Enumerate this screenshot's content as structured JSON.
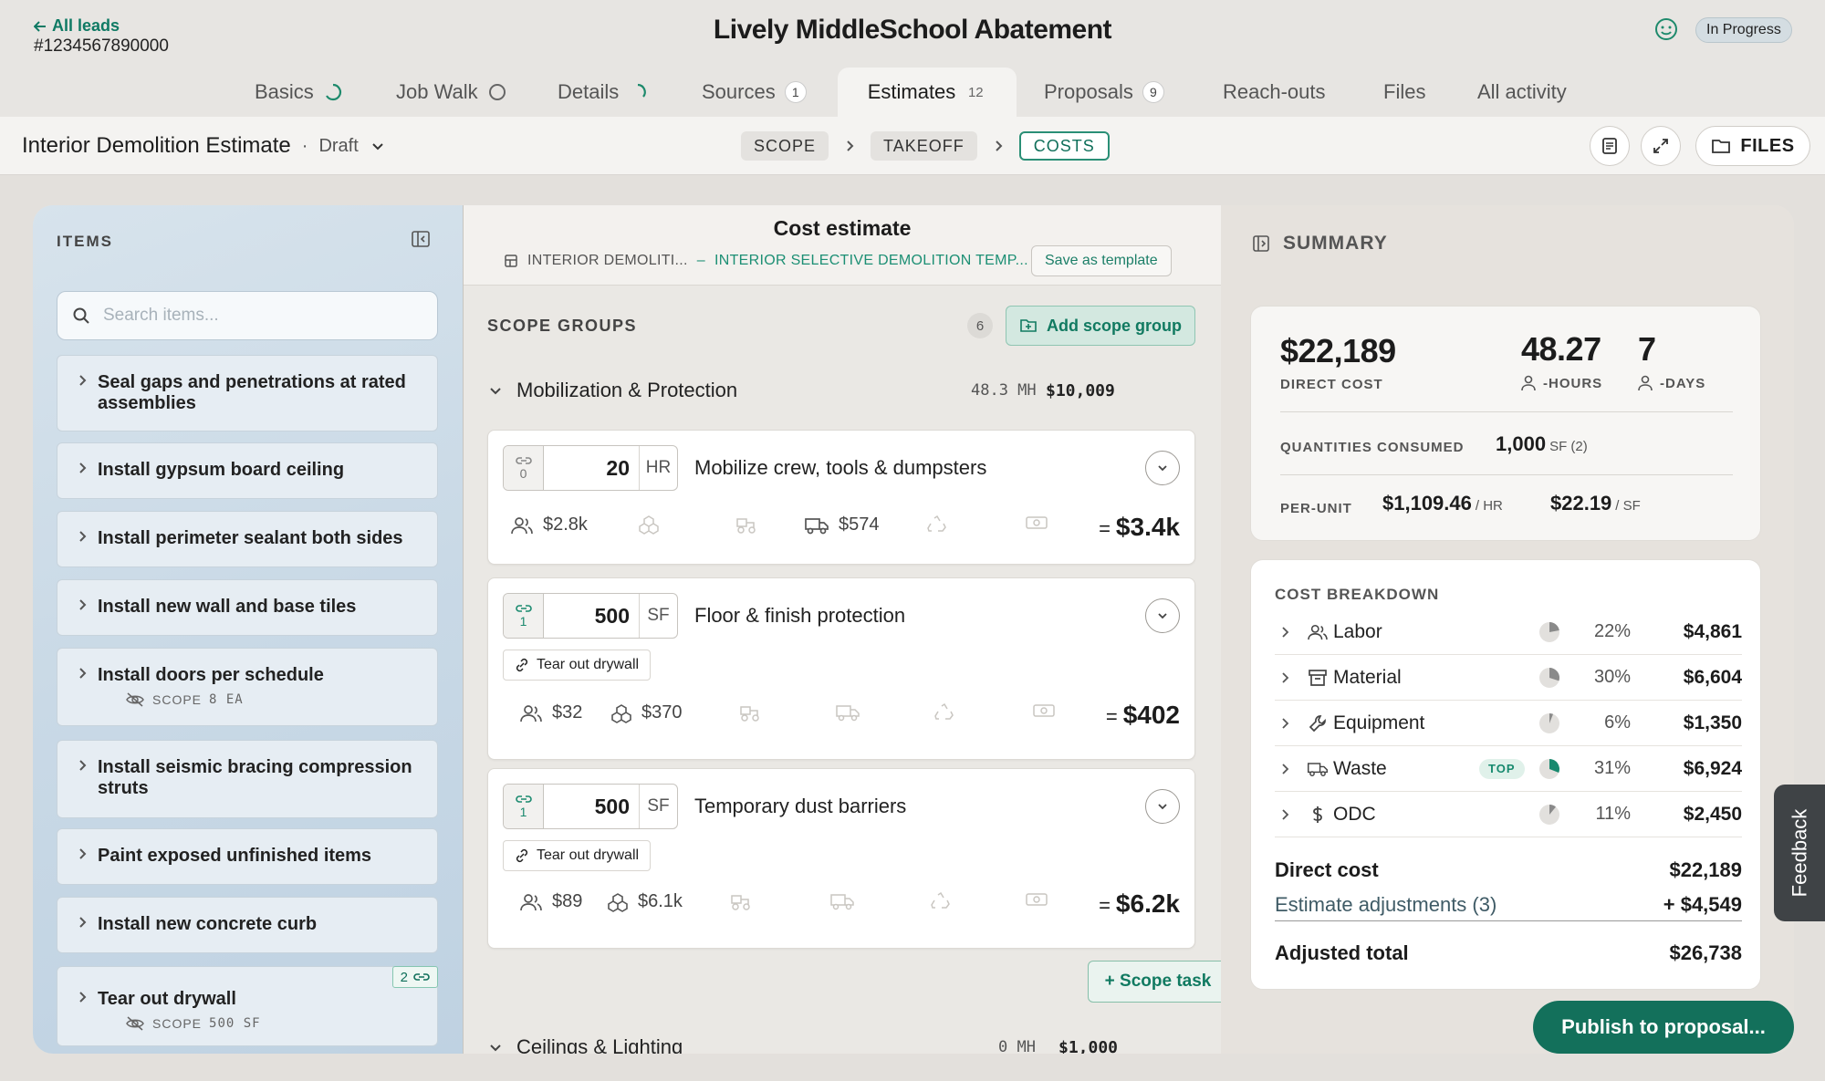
{
  "header": {
    "back_label": "All leads",
    "lead_id": "#1234567890000",
    "title": "Lively MiddleSchool Abatement",
    "status": "In Progress"
  },
  "tabs": [
    {
      "label": "Basics",
      "indicator": "progress-spinner-icon"
    },
    {
      "label": "Job Walk",
      "indicator": "empty-circle-icon"
    },
    {
      "label": "Details",
      "indicator": "progress-spinner-icon"
    },
    {
      "label": "Sources",
      "badge": "1"
    },
    {
      "label": "Estimates",
      "badge": "12",
      "active": true
    },
    {
      "label": "Proposals",
      "badge": "9"
    },
    {
      "label": "Reach-outs"
    },
    {
      "label": "Files"
    },
    {
      "label": "All activity"
    }
  ],
  "subbar": {
    "estimate_name": "Interior Demolition Estimate",
    "estimate_status": "Draft",
    "steps": [
      "SCOPE",
      "TAKEOFF",
      "COSTS"
    ],
    "current_step": "COSTS",
    "files_label": "FILES"
  },
  "items_panel": {
    "heading": "ITEMS",
    "search_placeholder": "Search items...",
    "items": [
      {
        "name": "Seal gaps and penetrations at rated assemblies"
      },
      {
        "name": "Install gypsum board ceiling"
      },
      {
        "name": "Install perimeter sealant both sides"
      },
      {
        "name": "Install new wall and base tiles"
      },
      {
        "name": "Install doors per schedule",
        "scope_label": "SCOPE",
        "scope_value": "8 EA"
      },
      {
        "name": "Install seismic bracing compression struts"
      },
      {
        "name": "Paint exposed unfinished items"
      },
      {
        "name": "Install new concrete curb"
      },
      {
        "name": "Tear out drywall",
        "scope_label": "SCOPE",
        "scope_value": "500 SF",
        "link_count": "2"
      }
    ]
  },
  "cost_estimate": {
    "title": "Cost estimate",
    "path_item": "INTERIOR DEMOLITI...",
    "path_separator": "–",
    "path_template": "INTERIOR SELECTIVE DEMOLITION TEMP...",
    "save_template_label": "Save as template",
    "scope_groups_heading": "SCOPE GROUPS",
    "scope_group_count": "6",
    "add_scope_group_label": "Add scope group",
    "groups": [
      {
        "name": "Mobilization & Protection",
        "mh": "48.3 MH",
        "value": "$10,009"
      },
      {
        "name": "Ceilings & Lighting",
        "mh": "0 MH",
        "value": "$1,000"
      }
    ],
    "tasks": [
      {
        "link_count": "0",
        "quantity": "20",
        "unit": "HR",
        "name": "Mobilize crew, tools & dumpsters",
        "tag": "",
        "labor": "$2.8k",
        "material": "",
        "equipment": "",
        "waste": "$574",
        "recycle": "",
        "odc": "",
        "total_eq": "=",
        "total": "$3.4k"
      },
      {
        "link_count": "1",
        "quantity": "500",
        "unit": "SF",
        "name": "Floor & finish protection",
        "tag": "Tear out drywall",
        "labor": "$32",
        "material": "$370",
        "equipment": "",
        "waste": "",
        "recycle": "",
        "odc": "",
        "total_eq": "=",
        "total": "$402"
      },
      {
        "link_count": "1",
        "quantity": "500",
        "unit": "SF",
        "name": "Temporary dust barriers",
        "tag": "Tear out drywall",
        "labor": "$89",
        "material": "$6.1k",
        "equipment": "",
        "waste": "",
        "recycle": "",
        "odc": "",
        "total_eq": "=",
        "total": "$6.2k"
      }
    ],
    "scope_task_label": "+ Scope task"
  },
  "summary": {
    "heading": "SUMMARY",
    "direct_cost": "$22,189",
    "direct_cost_label": "DIRECT COST",
    "hours": "48.27",
    "hours_label": "-HOURS",
    "days": "7",
    "days_label": "-DAYS",
    "quantities_label": "QUANTITIES CONSUMED",
    "quantities_value": "1,000",
    "quantities_unit": "SF (2)",
    "per_unit_label": "PER-UNIT",
    "per_hr_value": "$1,109.46",
    "per_hr_unit": "/ HR",
    "per_sf_value": "$22.19",
    "per_sf_unit": "/ SF"
  },
  "cost_breakdown": {
    "heading": "COST BREAKDOWN",
    "rows": [
      {
        "name": "Labor",
        "icon": "people-icon",
        "percent": "22%",
        "fraction": 0.22,
        "amount": "$4,861",
        "top": ""
      },
      {
        "name": "Material",
        "icon": "archive-box-icon",
        "percent": "30%",
        "fraction": 0.3,
        "amount": "$6,604",
        "top": ""
      },
      {
        "name": "Equipment",
        "icon": "wrench-icon",
        "percent": "6%",
        "fraction": 0.06,
        "amount": "$1,350",
        "top": ""
      },
      {
        "name": "Waste",
        "icon": "truck-icon",
        "percent": "31%",
        "fraction": 0.31,
        "amount": "$6,924",
        "top": "TOP"
      },
      {
        "name": "ODC",
        "icon": "dollar-icon",
        "percent": "11%",
        "fraction": 0.11,
        "amount": "$2,450",
        "top": ""
      }
    ],
    "direct_cost_label": "Direct cost",
    "direct_cost_value": "$22,189",
    "adjustments_label": "Estimate adjustments (3)",
    "adjustments_value": "+ $4,549",
    "adjusted_total_label": "Adjusted total",
    "adjusted_total_value": "$26,738"
  },
  "actions": {
    "publish_label": "Publish to proposal...",
    "feedback_label": "Feedback"
  },
  "colors": {
    "accent": "#13705b",
    "accent_light": "#d3e8e0",
    "pie_gray": "#8a8a8a",
    "pie_top": "#17896e"
  }
}
